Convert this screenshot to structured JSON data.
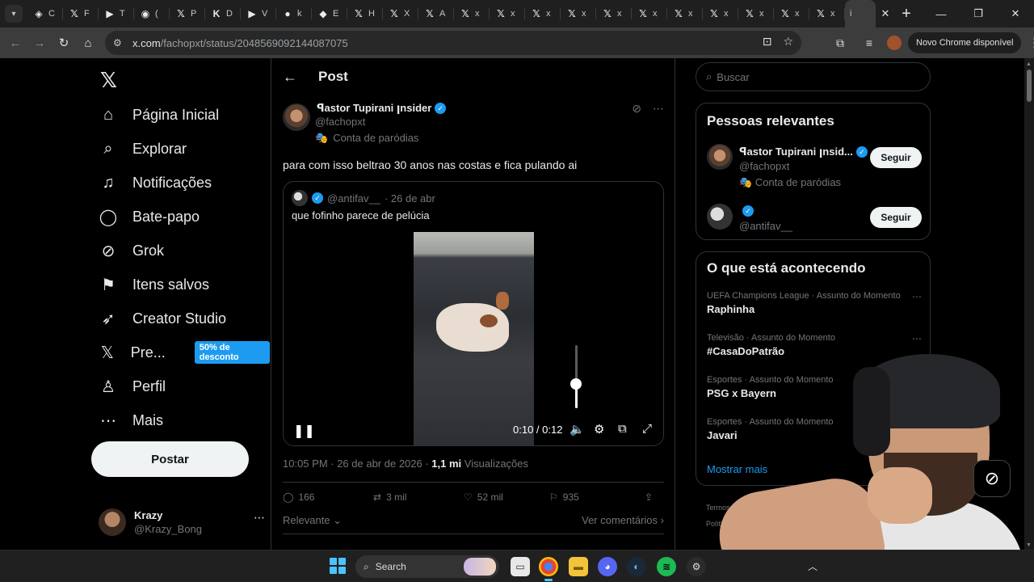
{
  "browser": {
    "tabs": [
      {
        "icon": "◈",
        "title": "C"
      },
      {
        "icon": "𝕏",
        "title": "F"
      },
      {
        "icon": "▶",
        "title": "T"
      },
      {
        "icon": "◉",
        "title": "("
      },
      {
        "icon": "𝕏",
        "title": "P"
      },
      {
        "icon": "K",
        "title": "D"
      },
      {
        "icon": "▶",
        "title": "V"
      },
      {
        "icon": "●",
        "title": "k"
      },
      {
        "icon": "◆",
        "title": "E"
      },
      {
        "icon": "𝕏",
        "title": "H"
      },
      {
        "icon": "𝕏",
        "title": "X"
      },
      {
        "icon": "𝕏",
        "title": "A"
      },
      {
        "icon": "𝕏",
        "title": "x"
      },
      {
        "icon": "𝕏",
        "title": "x"
      },
      {
        "icon": "𝕏",
        "title": "x"
      },
      {
        "icon": "𝕏",
        "title": "x"
      },
      {
        "icon": "𝕏",
        "title": "x"
      },
      {
        "icon": "𝕏",
        "title": "x"
      },
      {
        "icon": "𝕏",
        "title": "x"
      },
      {
        "icon": "𝕏",
        "title": "x"
      },
      {
        "icon": "𝕏",
        "title": "x"
      },
      {
        "icon": "𝕏",
        "title": "x"
      },
      {
        "icon": "𝕏",
        "title": "x"
      }
    ],
    "active_tab_title": "i",
    "url_host": "x.com",
    "url_path": "/fachopxt/status/2048569092144087075",
    "update_chip": "Novo Chrome disponível"
  },
  "nav": {
    "items": [
      {
        "icon": "⌂",
        "label": "Página Inicial"
      },
      {
        "icon": "⌕",
        "label": "Explorar"
      },
      {
        "icon": "♫",
        "label": "Notificações"
      },
      {
        "icon": "◯",
        "label": "Bate-papo"
      },
      {
        "icon": "⊘",
        "label": "Grok"
      },
      {
        "icon": "⚑",
        "label": "Itens salvos"
      },
      {
        "icon": "➶",
        "label": "Creator Studio"
      },
      {
        "icon": "𝕏",
        "label": "Pre..."
      },
      {
        "icon": "♙",
        "label": "Perfil"
      },
      {
        "icon": "⋯",
        "label": "Mais"
      }
    ],
    "promo_badge": "50% de desconto",
    "post_button": "Postar",
    "account_name": "Krazy",
    "account_handle": "@Krazy_Bong"
  },
  "post": {
    "header_title": "Post",
    "author_name": "ꟼastor Tupirani ꞁnsider",
    "author_handle": "@fachopxt",
    "author_label": "Conta de paródias",
    "text": "para com isso beltrao 30 anos nas costas e fica pulando ai",
    "quote": {
      "handle": "@antifav__",
      "date": "· 26 de abr",
      "text": "que fofinho parece de pelúcia"
    },
    "video": {
      "time": "0:10 / 0:12",
      "volume_level": 0.38
    },
    "timestamp": "10:05 PM · 26 de abr de 2026 · ",
    "views_count": "1,1 mi",
    "views_label": " Visualizações",
    "stats": {
      "replies": "166",
      "reposts": "3 mil",
      "likes": "52 mil",
      "bookmarks": "935"
    },
    "sort_label": "Relevante",
    "comments_link": "Ver comentários"
  },
  "sidebar": {
    "search_placeholder": "Buscar",
    "relevant_title": "Pessoas relevantes",
    "people": [
      {
        "name": "ꟼastor Tupirani ꞁnsid...",
        "handle": "@fachopxt",
        "label": "Conta de paródias",
        "follow": "Seguir"
      },
      {
        "name": "",
        "handle": "@antifav__",
        "label": "",
        "follow": "Seguir"
      }
    ],
    "trends_title": "O que está acontecendo",
    "trends": [
      {
        "meta": "UEFA Champions League · Assunto do Momento",
        "title": "Raphinha"
      },
      {
        "meta": "Televisão · Assunto do Momento",
        "title": "#CasaDoPatrão"
      },
      {
        "meta": "Esportes · Assunto do Momento",
        "title": "PSG x Bayern"
      },
      {
        "meta": "Esportes · Assunto do Momento",
        "title": "Javari"
      }
    ],
    "show_more": "Mostrar mais",
    "footer_1": "Termos de Serviço · Poli",
    "footer_2": "Política de co"
  },
  "taskbar": {
    "search_label": "Search"
  }
}
